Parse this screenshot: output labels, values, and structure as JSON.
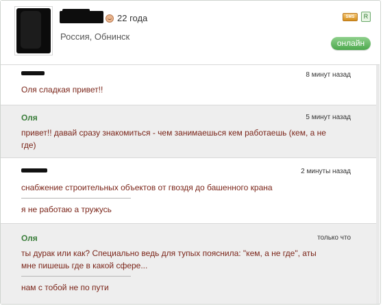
{
  "profile": {
    "age": "22 года",
    "location": "Россия, Обнинск",
    "sms_label": "SMS",
    "r_label": "R",
    "online_label": "онлайн"
  },
  "messages": [
    {
      "sender": "",
      "time": "8 минут назад",
      "text": "Оля сладкая привет!!"
    },
    {
      "sender": "Оля",
      "time": "5 минут назад",
      "text_line1": "привет!! давай сразу знакомиться - чем занимаешься кем работаешь (кем, а не",
      "text_line2": "где)"
    },
    {
      "sender": "",
      "time": "2 минуты назад",
      "text": "снабжение строительных объектов от гвоздя до башенного крана",
      "reply": "я не работаю а тружусь"
    },
    {
      "sender": "Оля",
      "time": "только что",
      "text_line1": "ты дурак или как? Специально ведь для тупых пояснила: \"кем, а не где\", аты",
      "text_line2": "мне пишешь где в какой сфере...",
      "reply": "нам с тобой не по пути"
    }
  ],
  "colors": {
    "accent_green": "#3a7d3a",
    "message_text": "#7a2418",
    "online_green": "#4ca84d"
  }
}
